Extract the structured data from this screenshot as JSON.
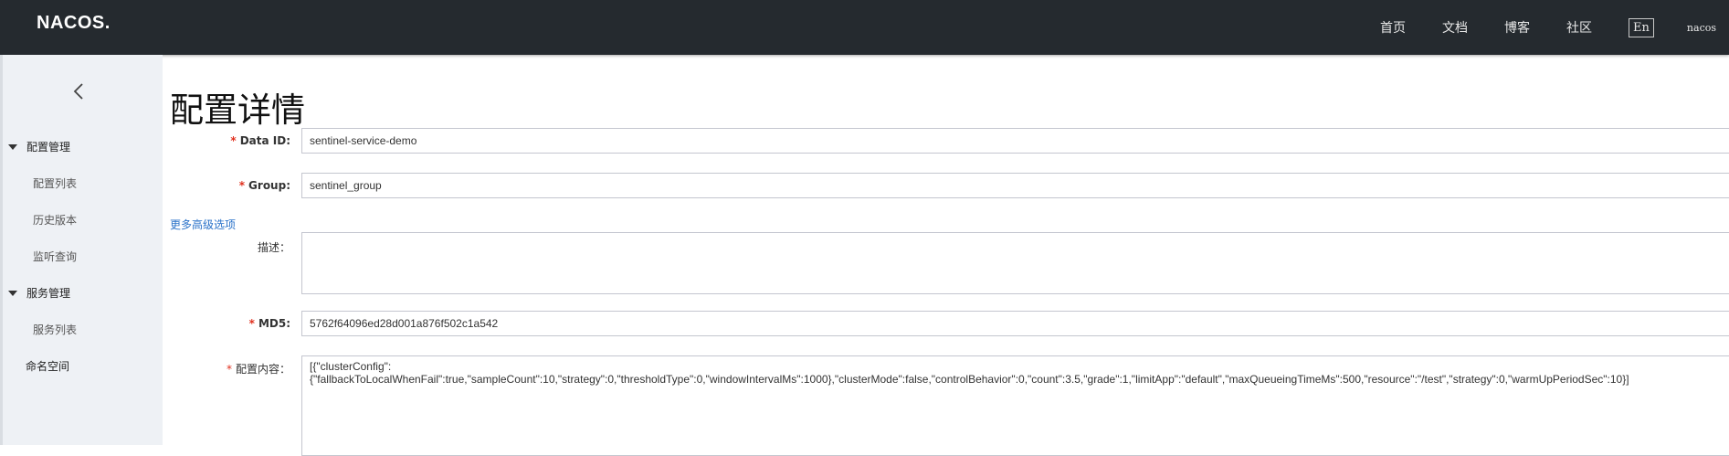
{
  "header": {
    "logo_text": "NACOS.",
    "nav": [
      "首页",
      "文档",
      "博客",
      "社区"
    ],
    "lang_button": "En",
    "user": "nacos"
  },
  "sidebar": {
    "collapse_icon": "chevron-left-icon",
    "groups": [
      {
        "label": "配置管理",
        "items": [
          "配置列表",
          "历史版本",
          "监听查询"
        ]
      },
      {
        "label": "服务管理",
        "items": [
          "服务列表"
        ]
      }
    ],
    "namespace_label": "命名空间"
  },
  "main": {
    "title": "配置详情",
    "fields": {
      "data_id": {
        "label": "Data ID:",
        "value": "sentinel-service-demo",
        "required": true
      },
      "group": {
        "label": "Group:",
        "value": "sentinel_group",
        "required": true
      },
      "advanced_link": "更多高级选项",
      "description": {
        "label": "描述：",
        "value": "",
        "required": false
      },
      "md5": {
        "label": "MD5:",
        "value": "5762f64096ed28d001a876f502c1a542",
        "required": true
      },
      "content": {
        "label": "配置内容：",
        "required": true,
        "value": "[{\"clusterConfig\":\n{\"fallbackToLocalWhenFail\":true,\"sampleCount\":10,\"strategy\":0,\"thresholdType\":0,\"windowIntervalMs\":1000},\"clusterMode\":false,\"controlBehavior\":0,\"count\":3.5,\"grade\":1,\"limitApp\":\"default\",\"maxQueueingTimeMs\":500,\"resource\":\"/test\",\"strategy\":0,\"warmUpPeriodSec\":10}]"
      }
    }
  },
  "colors": {
    "header_bg": "#252a2f",
    "sidebar_bg": "#eef1f5",
    "required_star": "#e0301e",
    "link": "#2a72c9"
  }
}
